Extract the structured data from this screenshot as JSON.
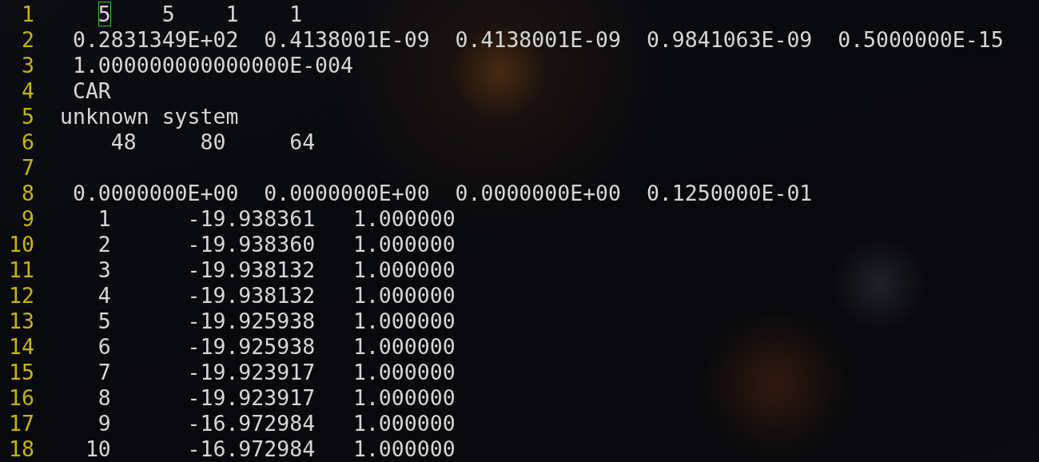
{
  "editor": {
    "lines": [
      {
        "number": "1",
        "cursor": "5",
        "after": "    5    1    1"
      },
      {
        "number": "2",
        "text": " 0.2831349E+02  0.4138001E-09  0.4138001E-09  0.9841063E-09  0.5000000E-15"
      },
      {
        "number": "3",
        "text": " 1.000000000000000E-004"
      },
      {
        "number": "4",
        "text": " CAR"
      },
      {
        "number": "5",
        "text": "unknown system"
      },
      {
        "number": "6",
        "text": "    48     80     64"
      },
      {
        "number": "7"
      },
      {
        "number": "8",
        "text": " 0.0000000E+00  0.0000000E+00  0.0000000E+00  0.1250000E-01"
      },
      {
        "number": "9",
        "text": "   1      -19.938361   1.000000"
      },
      {
        "number": "10",
        "text": "   2      -19.938360   1.000000"
      },
      {
        "number": "11",
        "text": "   3      -19.938132   1.000000"
      },
      {
        "number": "12",
        "text": "   4      -19.938132   1.000000"
      },
      {
        "number": "13",
        "text": "   5      -19.925938   1.000000"
      },
      {
        "number": "14",
        "text": "   6      -19.925938   1.000000"
      },
      {
        "number": "15",
        "text": "   7      -19.923917   1.000000"
      },
      {
        "number": "16",
        "text": "   8      -19.923917   1.000000"
      },
      {
        "number": "17",
        "text": "   9      -16.972984   1.000000"
      },
      {
        "number": "18",
        "text": "  10      -16.972984   1.000000"
      }
    ]
  }
}
